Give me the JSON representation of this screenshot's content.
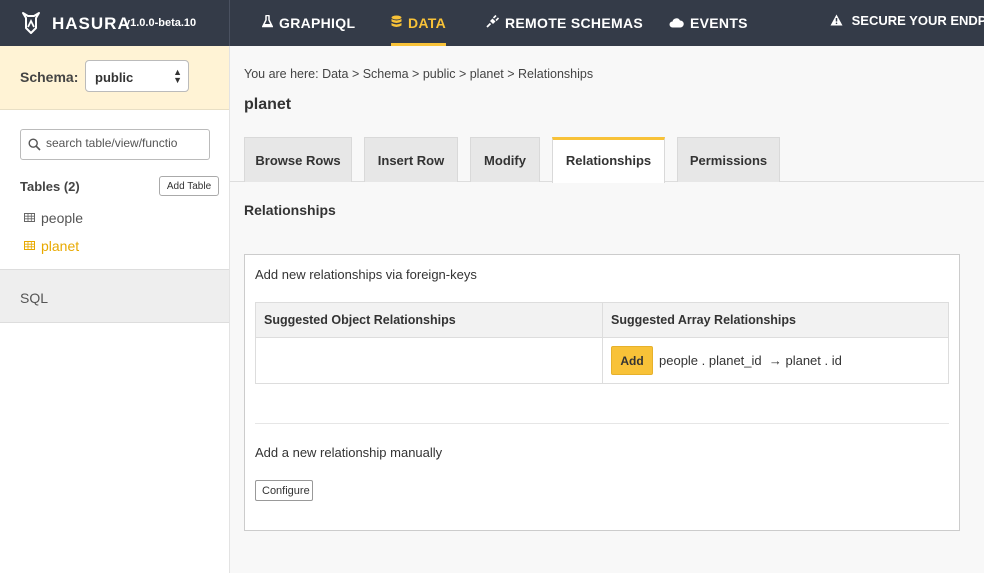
{
  "brand": {
    "name": "HASURA",
    "version": "v1.0.0-beta.10"
  },
  "nav": {
    "items": [
      {
        "label": "GRAPHIQL",
        "icon": "flask-icon"
      },
      {
        "label": "DATA",
        "icon": "database-icon",
        "active": true
      },
      {
        "label": "REMOTE SCHEMAS",
        "icon": "plug-icon"
      },
      {
        "label": "EVENTS",
        "icon": "cloud-icon"
      }
    ],
    "secure_label": "SECURE YOUR ENDPOI"
  },
  "sidebar": {
    "schema_label": "Schema:",
    "schema_value": "public",
    "search_placeholder": "search table/view/functio",
    "tables_heading": "Tables (2)",
    "add_table_label": "Add Table",
    "tables": [
      {
        "name": "people"
      },
      {
        "name": "planet",
        "active": true
      }
    ],
    "sql_label": "SQL"
  },
  "main": {
    "breadcrumb": "You are here: Data > Schema > public > planet > Relationships",
    "title": "planet",
    "tabs": [
      {
        "label": "Browse Rows"
      },
      {
        "label": "Insert Row"
      },
      {
        "label": "Modify"
      },
      {
        "label": "Relationships",
        "active": true
      },
      {
        "label": "Permissions"
      }
    ],
    "section_title": "Relationships",
    "panel": {
      "subtitle": "Add new relationships via foreign-keys",
      "col_object": "Suggested Object Relationships",
      "col_array": "Suggested Array Relationships",
      "add_label": "Add",
      "array_relationship": "people . planet_id  → planet . id",
      "manual_label": "Add a new relationship manually",
      "configure_label": "Configure"
    }
  },
  "colors": {
    "topbar": "#343b48",
    "accent": "#f8c238",
    "schema_bg": "#fff3d5",
    "active_table": "#e8a900"
  }
}
